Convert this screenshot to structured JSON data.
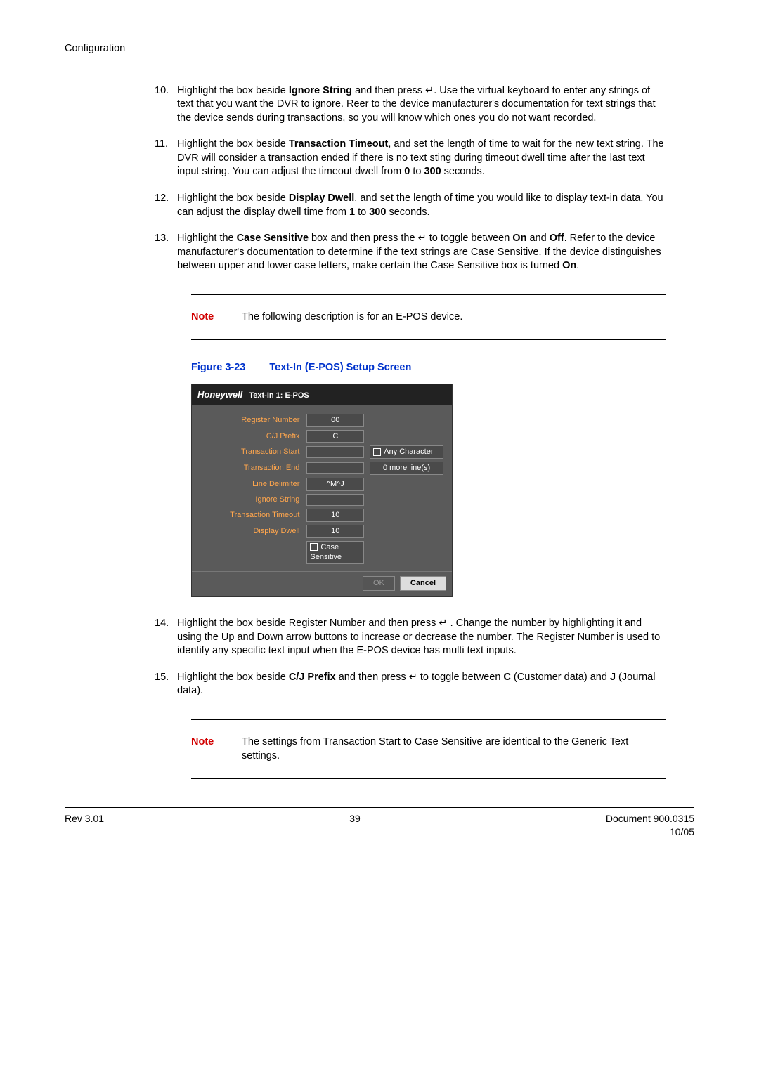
{
  "header": "Configuration",
  "steps": [
    {
      "num": "10.",
      "html": "Highlight the box beside <b>Ignore String</b> and then press <span class='enter-sym'>↵</span>. Use the virtual keyboard to enter any strings of text that you want the DVR to ignore. Reer to the device manufacturer's documentation for text strings that the device sends during transactions, so you will know which ones you do not want recorded."
    },
    {
      "num": "11.",
      "html": "Highlight the box beside <b>Transaction Timeout</b>, and set the length of time to wait for the new text string. The DVR will consider a transaction ended if there is no text sting during timeout dwell time after the last text input string. You can adjust the timeout dwell from <b>0</b> to <b>300</b> seconds."
    },
    {
      "num": "12.",
      "html": "Highlight the box beside <b>Display Dwell</b>, and set the length of time you would like to display text-in data. You can adjust the display dwell time from <b>1</b> to <b>300</b> seconds."
    },
    {
      "num": "13.",
      "html": "Highlight the <b>Case Sensitive</b> box and then press the <span class='enter-sym'>↵</span> to toggle between <b>On</b> and <b>Off</b>. Refer to the device manufacturer's documentation to determine if the text strings are Case Sensitive. If the device distinguishes between upper and lower case letters, make certain the Case Sensitive box is turned <b>On</b>."
    }
  ],
  "note1": {
    "label": "Note",
    "text": "The following description is for an E-POS device."
  },
  "figure": {
    "label": "Figure 3-23",
    "title": "Text-In (E-POS) Setup Screen"
  },
  "screenshot": {
    "brand": "Honeywell",
    "title": "Text-In 1: E-POS",
    "rows": [
      {
        "label": "Register Number",
        "value": "00",
        "extra": ""
      },
      {
        "label": "C/J Prefix",
        "value": "C",
        "extra": ""
      },
      {
        "label": "Transaction Start",
        "value": "",
        "extra_check": "Any Character"
      },
      {
        "label": "Transaction End",
        "value": "",
        "extra_box": "0 more line(s)"
      },
      {
        "label": "Line Delimiter",
        "value": "^M^J",
        "extra": ""
      },
      {
        "label": "Ignore String",
        "value": "",
        "extra": ""
      },
      {
        "label": "Transaction Timeout",
        "value": "10",
        "extra": ""
      },
      {
        "label": "Display Dwell",
        "value": "10",
        "extra": ""
      }
    ],
    "case_sensitive": "Case Sensitive",
    "ok": "OK",
    "cancel": "Cancel"
  },
  "steps2": [
    {
      "num": "14.",
      "html": "Highlight the box beside Register Number and then press <span class='enter-sym'>↵</span> . Change the number by highlighting it and using the Up and Down arrow buttons to increase or decrease the number. The Register Number is used to identify any specific text input when the E-POS device has multi text inputs."
    },
    {
      "num": "15.",
      "html": "Highlight the box beside <b>C/J Prefix</b> and then press <span class='enter-sym'>↵</span> to toggle between <b>C</b> (Customer data) and <b>J</b> (Journal data)."
    }
  ],
  "note2": {
    "label": "Note",
    "text": "The settings from Transaction Start to Case Sensitive are identical to the Generic Text settings."
  },
  "footer": {
    "rev": "Rev 3.01",
    "page": "39",
    "doc": "Document 900.0315",
    "date": "10/05"
  }
}
